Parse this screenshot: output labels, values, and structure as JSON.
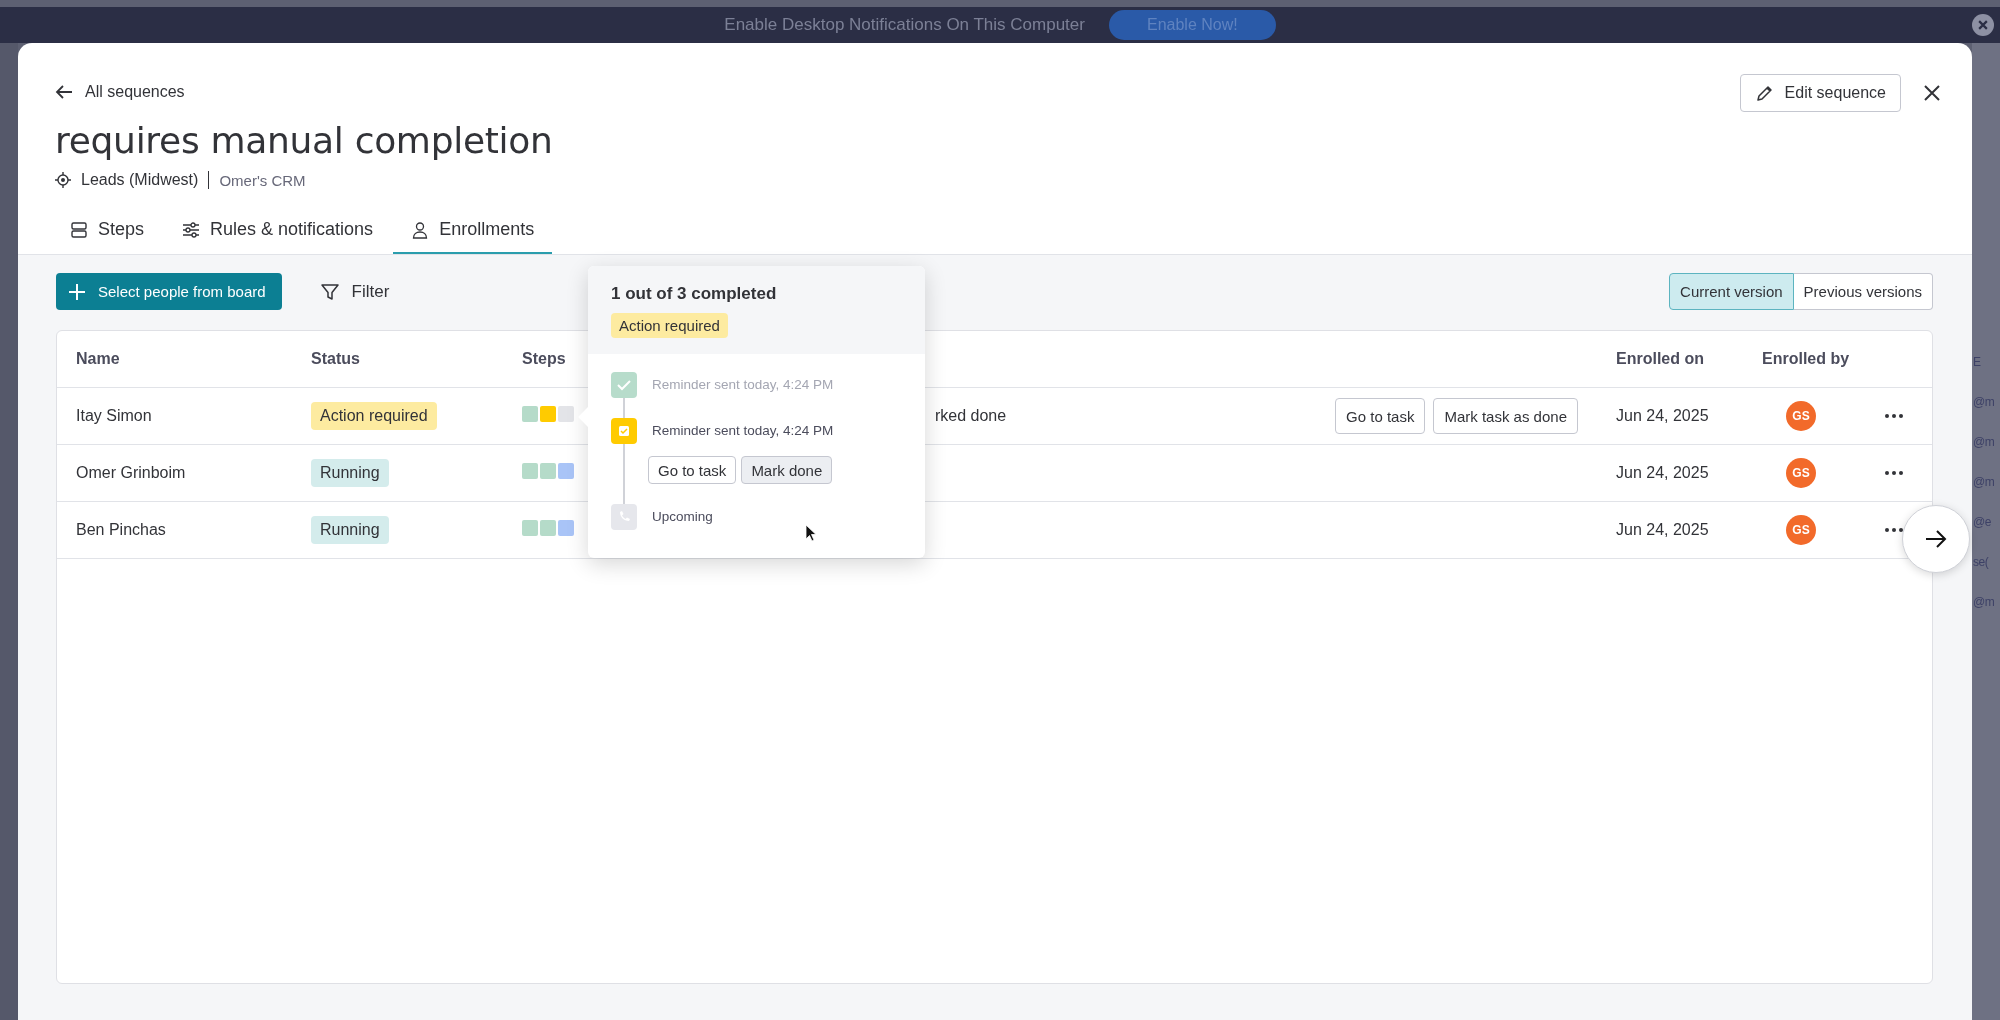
{
  "notification_bar": {
    "text": "Enable Desktop Notifications On This Computer",
    "button": "Enable Now!"
  },
  "background_app": {
    "fragments": [
      "E",
      "@m",
      "@m",
      "@m",
      "@e",
      "se(",
      "@m"
    ]
  },
  "modal": {
    "back_link": "All sequences",
    "title": "requires manual completion",
    "board": "Leads (Midwest)",
    "workspace": "Omer's CRM",
    "edit_button": "Edit sequence",
    "tabs": [
      {
        "label": "Steps",
        "selected": false
      },
      {
        "label": "Rules & notifications",
        "selected": false
      },
      {
        "label": "Enrollments",
        "selected": true
      }
    ],
    "toolbar": {
      "add_button": "Select people from board",
      "filter": "Filter",
      "versions": [
        {
          "label": "Current version",
          "selected": true
        },
        {
          "label": "Previous versions",
          "selected": false
        }
      ]
    },
    "table": {
      "columns": [
        "Name",
        "Status",
        "Steps",
        "Enrolled on",
        "Enrolled by"
      ],
      "rows": [
        {
          "name": "Itay Simon",
          "status": {
            "label": "Action required",
            "kind": "action"
          },
          "steps": [
            {
              "color": "#b5dbc9"
            },
            {
              "color": "#ffcb00"
            },
            {
              "color": "#e3e4e8"
            }
          ],
          "note": "rked done",
          "actions": [
            "Go to task",
            "Mark task as done"
          ],
          "enrolled_on": "Jun 24, 2025",
          "enrolled_by": "GS"
        },
        {
          "name": "Omer Grinboim",
          "status": {
            "label": "Running",
            "kind": "running"
          },
          "steps": [
            {
              "color": "#b5dbc9"
            },
            {
              "color": "#b5dbc9"
            },
            {
              "color": "#a9c4f7"
            }
          ],
          "enrolled_on": "Jun 24, 2025",
          "enrolled_by": "GS"
        },
        {
          "name": "Ben Pinchas",
          "status": {
            "label": "Running",
            "kind": "running"
          },
          "steps": [
            {
              "color": "#b5dbc9"
            },
            {
              "color": "#b5dbc9"
            },
            {
              "color": "#a9c4f7"
            }
          ],
          "enrolled_on": "Jun 24, 2025",
          "enrolled_by": "GS"
        }
      ]
    },
    "popover": {
      "title": "1 out of 3 completed",
      "badge": "Action required",
      "steps": [
        {
          "kind": "done",
          "text": "Reminder sent today, 4:24 PM"
        },
        {
          "kind": "action",
          "text": "Reminder sent today, 4:24 PM",
          "buttons": [
            "Go to task",
            "Mark done"
          ]
        },
        {
          "kind": "upcoming",
          "text": "Upcoming"
        }
      ]
    }
  }
}
